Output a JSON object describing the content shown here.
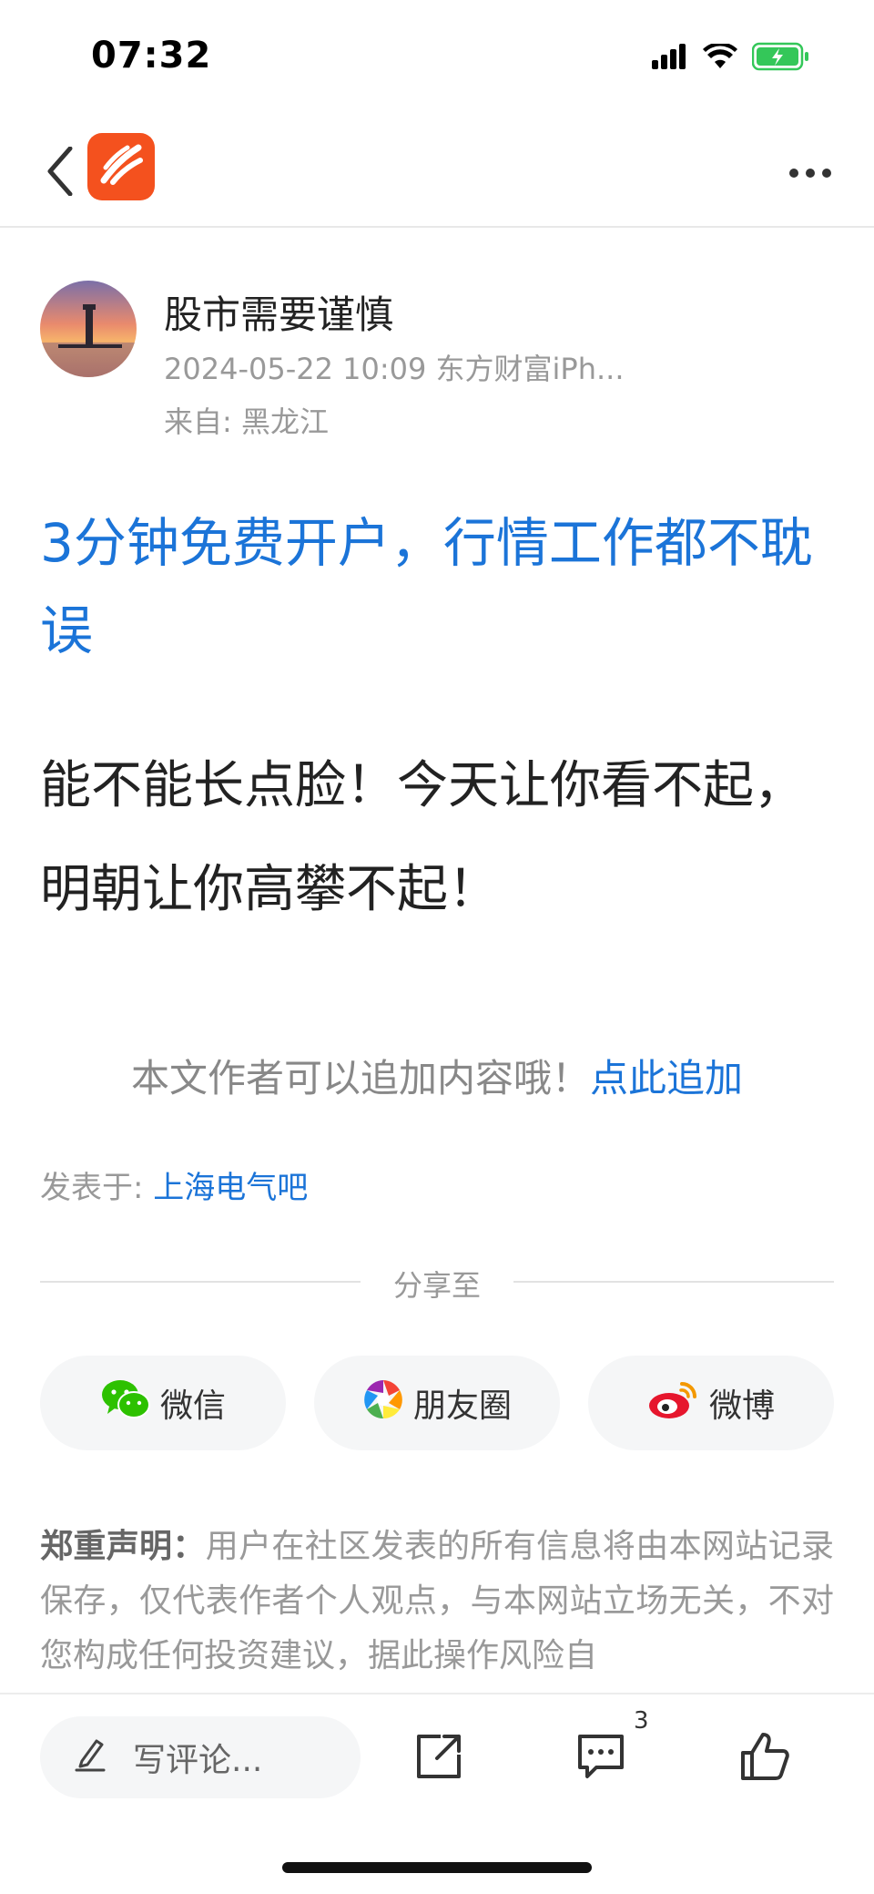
{
  "status_bar": {
    "time": "07:32",
    "icons": [
      "signal-icon",
      "wifi-icon",
      "battery-charging-icon"
    ],
    "battery_color": "#34c759"
  },
  "nav": {
    "back_icon": "chevron-left-icon",
    "logo_icon": "eastmoney-logo",
    "more_icon": "more-dots-icon",
    "logo_color": "#f4511e"
  },
  "author": {
    "name": "股市需要谨慎",
    "meta": "2024-05-22 10:09 东方财富iPh...",
    "origin": "来自: 黑龙江"
  },
  "post": {
    "promo_link": "3分钟免费开户，行情工作都不耽误",
    "body": "能不能长点脸！今天让你看不起，明朝让你高攀不起！"
  },
  "append": {
    "prompt": "本文作者可以追加内容哦！",
    "link": "点此追加"
  },
  "posted_in": {
    "label": "发表于: ",
    "forum": "上海电气吧"
  },
  "share": {
    "label": "分享至",
    "options": [
      {
        "label": "微信",
        "icon": "wechat-icon"
      },
      {
        "label": "朋友圈",
        "icon": "moments-icon"
      },
      {
        "label": "微博",
        "icon": "weibo-icon"
      }
    ]
  },
  "disclaimer": {
    "title": "郑重声明：",
    "text": "用户在社区发表的所有信息将由本网站记录保存，仅代表作者个人观点，与本网站立场无关，不对您构成任何投资建议，据此操作风险自"
  },
  "bottom_bar": {
    "comment_placeholder": "写评论...",
    "comment_count": "3",
    "icons": [
      "edit-icon",
      "share-out-icon",
      "comment-icon",
      "like-icon"
    ]
  },
  "colors": {
    "link": "#1b74d8",
    "muted": "#999999",
    "text": "#222222"
  }
}
